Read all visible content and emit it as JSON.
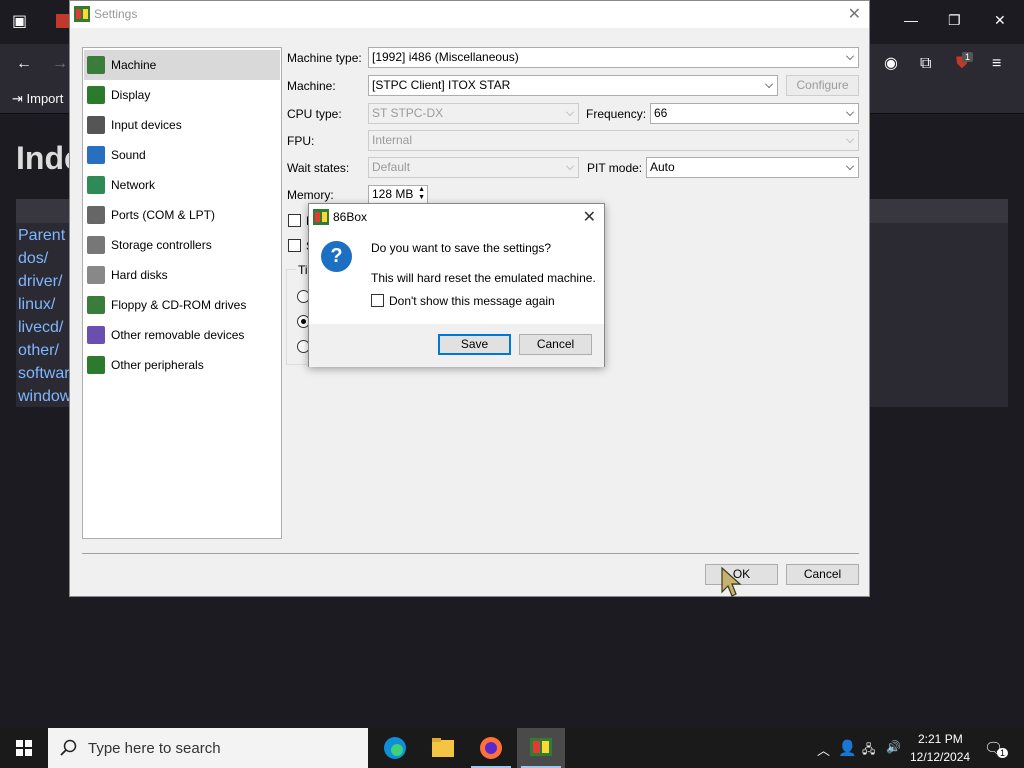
{
  "browser": {
    "bookmark_import": "Import",
    "heading": "Inde",
    "links": [
      "Parent",
      "dos/",
      "driver/",
      "linux/",
      "livecd/",
      "other/",
      "softwar",
      "window"
    ],
    "extension_badge": "1"
  },
  "settings": {
    "title": "Settings",
    "nav": [
      {
        "label": "Machine",
        "icon": "machine-icon",
        "color": "#3a7d3a"
      },
      {
        "label": "Display",
        "icon": "display-icon",
        "color": "#2c7a2c"
      },
      {
        "label": "Input devices",
        "icon": "input-devices-icon",
        "color": "#555555"
      },
      {
        "label": "Sound",
        "icon": "sound-icon",
        "color": "#2a6fbf"
      },
      {
        "label": "Network",
        "icon": "network-icon",
        "color": "#2e8b57"
      },
      {
        "label": "Ports (COM & LPT)",
        "icon": "ports-icon",
        "color": "#666666"
      },
      {
        "label": "Storage controllers",
        "icon": "storage-controllers-icon",
        "color": "#777777"
      },
      {
        "label": "Hard disks",
        "icon": "hard-disks-icon",
        "color": "#888888"
      },
      {
        "label": "Floppy & CD-ROM drives",
        "icon": "floppy-cdrom-icon",
        "color": "#3a7d3a"
      },
      {
        "label": "Other removable devices",
        "icon": "removable-devices-icon",
        "color": "#6a4fb0"
      },
      {
        "label": "Other peripherals",
        "icon": "peripherals-icon",
        "color": "#2c7a2c"
      }
    ],
    "machine_type_label": "Machine type:",
    "machine_type_value": "[1992] i486 (Miscellaneous)",
    "machine_label": "Machine:",
    "machine_value": "[STPC Client] ITOX STAR",
    "configure_label": "Configure",
    "cpu_type_label": "CPU type:",
    "cpu_type_value": "ST STPC-DX",
    "frequency_label": "Frequency:",
    "frequency_value": "66",
    "fpu_label": "FPU:",
    "fpu_value": "Internal",
    "wait_states_label": "Wait states:",
    "wait_states_value": "Default",
    "pit_mode_label": "PIT mode:",
    "pit_mode_value": "Auto",
    "memory_label": "Memory:",
    "memory_value": "128 MB",
    "checkbox1_partial": "D",
    "checkbox2_partial": "S",
    "group_partial": "Ti",
    "ok_label": "OK",
    "cancel_label": "Cancel"
  },
  "dialog": {
    "title": "86Box",
    "question": "Do you want to save the settings?",
    "detail": "This will hard reset the emulated machine.",
    "dont_show": "Don't show this message again",
    "save_label": "Save",
    "cancel_label": "Cancel"
  },
  "taskbar": {
    "search_placeholder": "Type here to search",
    "time": "2:21 PM",
    "date": "12/12/2024",
    "notification_count": "1"
  }
}
